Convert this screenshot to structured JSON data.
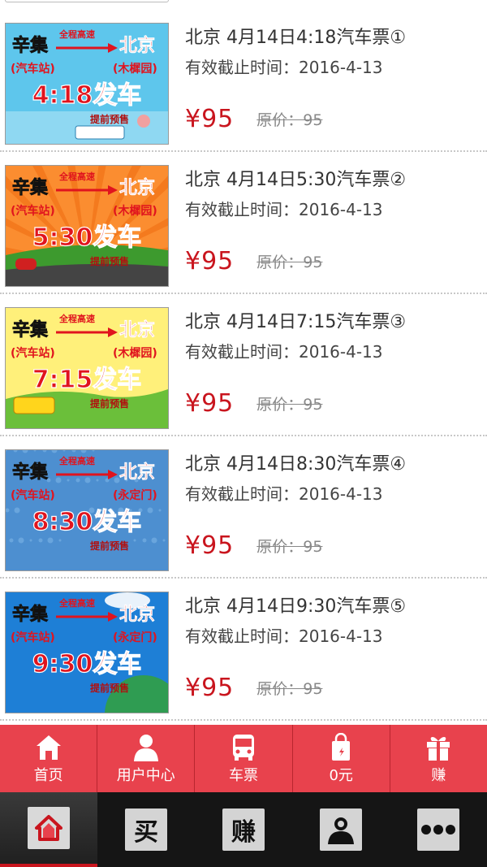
{
  "tickets": [
    {
      "title": "北京 4月14日4:18汽车票①",
      "deadline_label": "有效截止时间：",
      "deadline_value": "2016-4-13",
      "price": "¥95",
      "original_price": "原价：95",
      "banner": {
        "from": "辛集",
        "from_sub": "(汽车站)",
        "to": "北京",
        "to_sub": "(木樨园)",
        "route": "全程高速",
        "time": "4:18发车",
        "presale": "提前预售",
        "theme": "sky-bus"
      }
    },
    {
      "title": "北京 4月14日5:30汽车票②",
      "deadline_label": "有效截止时间：",
      "deadline_value": "2016-4-13",
      "price": "¥95",
      "original_price": "原价：95",
      "banner": {
        "from": "辛集",
        "from_sub": "(汽车站)",
        "to": "北京",
        "to_sub": "(木樨园)",
        "route": "全程高速",
        "time": "5:30发车",
        "presale": "提前预售",
        "theme": "orange-road"
      }
    },
    {
      "title": "北京 4月14日7:15汽车票③",
      "deadline_label": "有效截止时间：",
      "deadline_value": "2016-4-13",
      "price": "¥95",
      "original_price": "原价：95",
      "banner": {
        "from": "辛集",
        "from_sub": "(汽车站)",
        "to": "北京",
        "to_sub": "(木樨园)",
        "route": "全程高速",
        "time": "7:15发车",
        "presale": "提前预售",
        "theme": "yellow-bus"
      }
    },
    {
      "title": "北京 4月14日8:30汽车票④",
      "deadline_label": "有效截止时间：",
      "deadline_value": "2016-4-13",
      "price": "¥95",
      "original_price": "原价：95",
      "banner": {
        "from": "辛集",
        "from_sub": "(汽车站)",
        "to": "北京",
        "to_sub": "(永定门)",
        "route": "全程高速",
        "time": "8:30发车",
        "presale": "提前预售",
        "theme": "blue-grunge"
      }
    },
    {
      "title": "北京 4月14日9:30汽车票⑤",
      "deadline_label": "有效截止时间：",
      "deadline_value": "2016-4-13",
      "price": "¥95",
      "original_price": "原价：95",
      "banner": {
        "from": "辛集",
        "from_sub": "(汽车站)",
        "to": "北京",
        "to_sub": "(永定门)",
        "route": "全程高速",
        "time": "9:30发车",
        "presale": "提前预售",
        "theme": "blue-globe"
      }
    }
  ],
  "bottom_nav": [
    {
      "label": "首页",
      "icon": "home-icon"
    },
    {
      "label": "用户中心",
      "icon": "user-icon"
    },
    {
      "label": "车票",
      "icon": "bus-icon"
    },
    {
      "label": "0元",
      "icon": "shopping-bag-icon"
    },
    {
      "label": "赚",
      "icon": "gift-icon"
    }
  ],
  "system_bar": [
    {
      "icon": "home-icon",
      "active": true
    },
    {
      "text": "买",
      "icon": "buy-icon"
    },
    {
      "text": "赚",
      "icon": "earn-icon"
    },
    {
      "icon": "profile-icon"
    },
    {
      "icon": "more-icon"
    }
  ],
  "colors": {
    "accent_red": "#c9151e",
    "nav_red": "#e8424d",
    "system_bar": "#151515",
    "banner_text_red": "#e0141e",
    "banner_text_yellow": "#ffe600"
  }
}
